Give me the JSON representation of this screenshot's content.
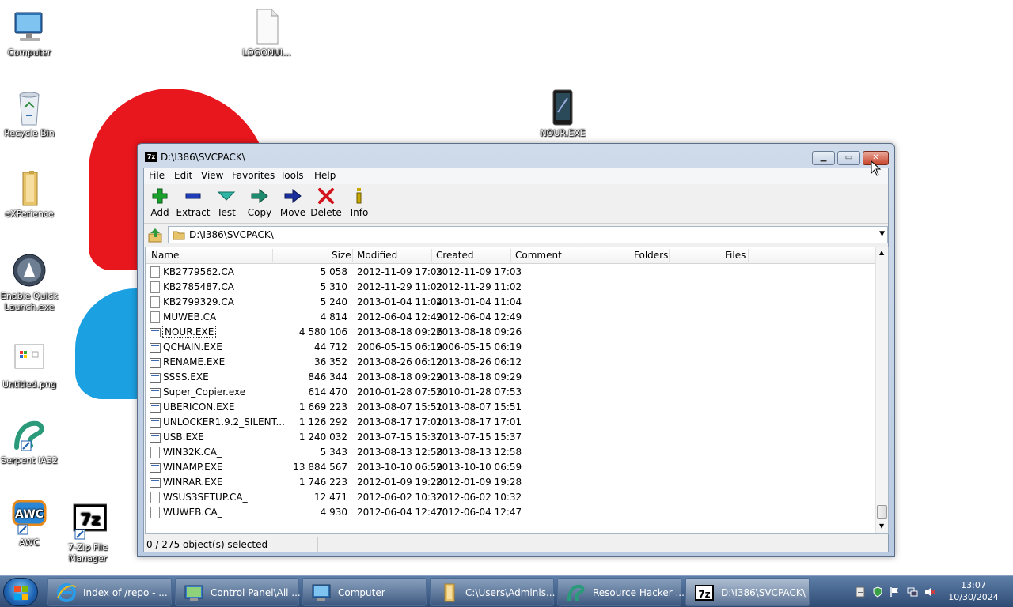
{
  "desktop": {
    "icons": [
      {
        "label": "Computer",
        "icon": "computer-icon"
      },
      {
        "label": "LOGONUI...",
        "icon": "file-icon"
      },
      {
        "label": "Recycle Bin",
        "icon": "recycle-bin-icon"
      },
      {
        "label": "NOUR.EXE",
        "icon": "exe-icon"
      },
      {
        "label": "eXPerience",
        "icon": "folder-icon"
      },
      {
        "label": "Enable Quick Launch.exe",
        "icon": "quick-launch-icon"
      },
      {
        "label": "Untitled.png",
        "icon": "image-icon"
      },
      {
        "label": "Serpent IA32",
        "icon": "serpent-icon"
      },
      {
        "label": "AWC",
        "icon": "awc-icon"
      },
      {
        "label": "7-Zip File Manager",
        "icon": "7zip-icon"
      }
    ]
  },
  "window": {
    "title": "D:\\I386\\SVCPACK\\",
    "menu": [
      "File",
      "Edit",
      "View",
      "Favorites",
      "Tools",
      "Help"
    ],
    "toolbar": [
      {
        "label": "Add",
        "icon": "add-icon",
        "color": "#1aa12c"
      },
      {
        "label": "Extract",
        "icon": "extract-icon",
        "color": "#1f3db8"
      },
      {
        "label": "Test",
        "icon": "test-icon",
        "color": "#2fb5a4"
      },
      {
        "label": "Copy",
        "icon": "copy-icon",
        "color": "#1e8a6e"
      },
      {
        "label": "Move",
        "icon": "move-icon",
        "color": "#1a2f9c"
      },
      {
        "label": "Delete",
        "icon": "delete-icon",
        "color": "#d4141c"
      },
      {
        "label": "Info",
        "icon": "info-icon",
        "color": "#c9a800"
      }
    ],
    "address": "D:\\I386\\SVCPACK\\",
    "columns": [
      "Name",
      "Size",
      "Modified",
      "Created",
      "Comment",
      "Folders",
      "Files"
    ],
    "files": [
      {
        "name": "KB2779562.CA_",
        "size": "5 058",
        "modified": "2012-11-09 17:03",
        "created": "2012-11-09 17:03",
        "type": "file"
      },
      {
        "name": "KB2785487.CA_",
        "size": "5 310",
        "modified": "2012-11-29 11:02",
        "created": "2012-11-29 11:02",
        "type": "file"
      },
      {
        "name": "KB2799329.CA_",
        "size": "5 240",
        "modified": "2013-01-04 11:04",
        "created": "2013-01-04 11:04",
        "type": "file"
      },
      {
        "name": "MUWEB.CA_",
        "size": "4 814",
        "modified": "2012-06-04 12:49",
        "created": "2012-06-04 12:49",
        "type": "file"
      },
      {
        "name": "NOUR.EXE",
        "size": "4 580 106",
        "modified": "2013-08-18 09:26",
        "created": "2013-08-18 09:26",
        "type": "exe"
      },
      {
        "name": "QCHAIN.EXE",
        "size": "44 712",
        "modified": "2006-05-15 06:19",
        "created": "2006-05-15 06:19",
        "type": "exe"
      },
      {
        "name": "RENAME.EXE",
        "size": "36 352",
        "modified": "2013-08-26 06:12",
        "created": "2013-08-26 06:12",
        "type": "exe"
      },
      {
        "name": "SSSS.EXE",
        "size": "846 344",
        "modified": "2013-08-18 09:29",
        "created": "2013-08-18 09:29",
        "type": "exe"
      },
      {
        "name": "Super_Copier.exe",
        "size": "614 470",
        "modified": "2010-01-28 07:53",
        "created": "2010-01-28 07:53",
        "type": "exe"
      },
      {
        "name": "UBERICON.EXE",
        "size": "1 669 223",
        "modified": "2013-08-07 15:51",
        "created": "2013-08-07 15:51",
        "type": "exe"
      },
      {
        "name": "UNLOCKER1.9.2_SILENT...",
        "size": "1 126 292",
        "modified": "2013-08-17 17:01",
        "created": "2013-08-17 17:01",
        "type": "exe"
      },
      {
        "name": "USB.EXE",
        "size": "1 240 032",
        "modified": "2013-07-15 15:37",
        "created": "2013-07-15 15:37",
        "type": "exe"
      },
      {
        "name": "WIN32K.CA_",
        "size": "5 343",
        "modified": "2013-08-13 12:58",
        "created": "2013-08-13 12:58",
        "type": "file"
      },
      {
        "name": "WINAMP.EXE",
        "size": "13 884 567",
        "modified": "2013-10-10 06:59",
        "created": "2013-10-10 06:59",
        "type": "exe"
      },
      {
        "name": "WINRAR.EXE",
        "size": "1 746 223",
        "modified": "2012-01-09 19:28",
        "created": "2012-01-09 19:28",
        "type": "exe"
      },
      {
        "name": "WSUS3SETUP.CA_",
        "size": "12 471",
        "modified": "2012-06-02 10:32",
        "created": "2012-06-02 10:32",
        "type": "file"
      },
      {
        "name": "WUWEB.CA_",
        "size": "4 930",
        "modified": "2012-06-04 12:47",
        "created": "2012-06-04 12:47",
        "type": "file"
      }
    ],
    "status": "0 / 275 object(s) selected"
  },
  "taskbar": {
    "items": [
      {
        "label": "Index of /repo - ...",
        "icon": "ie-icon"
      },
      {
        "label": "Control Panel\\All ...",
        "icon": "control-panel-icon"
      },
      {
        "label": "Computer",
        "icon": "computer-icon"
      },
      {
        "label": "C:\\Users\\Adminis...",
        "icon": "folder-icon"
      },
      {
        "label": "Resource Hacker ...",
        "icon": "resource-hacker-icon"
      },
      {
        "label": "D:\\I386\\SVCPACK\\",
        "icon": "7zip-icon"
      }
    ],
    "clock_time": "13:07",
    "clock_date": "10/30/2024"
  }
}
